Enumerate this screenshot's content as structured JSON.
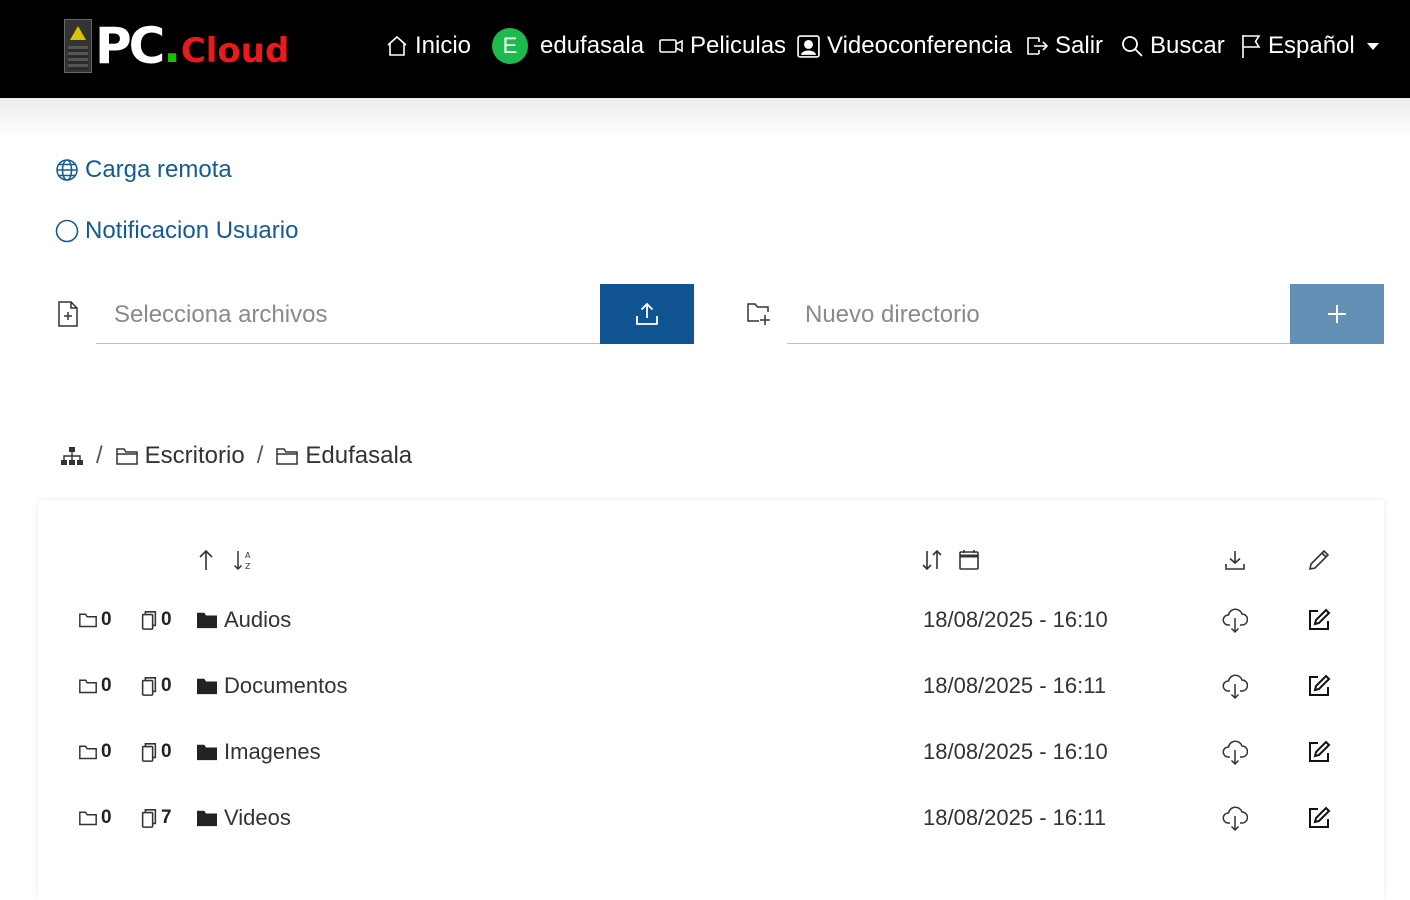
{
  "brand": {
    "pc": "PC",
    "dot": ".",
    "cloud": "Cloud"
  },
  "nav": {
    "home": "Inicio",
    "user_initial": "E",
    "user": "edufasala",
    "movies": "Peliculas",
    "videoconf": "Videoconferencia",
    "logout": "Salir",
    "search": "Buscar",
    "language": "Español"
  },
  "links": {
    "remote_upload": "Carga remota",
    "notification": "Notificacion Usuario"
  },
  "upload": {
    "placeholder": "Selecciona archivos"
  },
  "newdir": {
    "placeholder": "Nuevo directorio"
  },
  "breadcrumb": {
    "items": [
      "Escritorio",
      "Edufasala"
    ],
    "separator": "/"
  },
  "files": [
    {
      "folders": "0",
      "files": "0",
      "name": "Audios",
      "date": "18/08/2025 - 16:10"
    },
    {
      "folders": "0",
      "files": "0",
      "name": "Documentos",
      "date": "18/08/2025 - 16:11"
    },
    {
      "folders": "0",
      "files": "0",
      "name": "Imagenes",
      "date": "18/08/2025 - 16:10"
    },
    {
      "folders": "0",
      "files": "7",
      "name": "Videos",
      "date": "18/08/2025 - 16:11"
    }
  ],
  "colors": {
    "navbar": "#000000",
    "link": "#155a94",
    "upload_button": "#0f5390",
    "add_button": "#6490b6",
    "avatar": "#1fba4e",
    "brand_cloud": "#e81a1a"
  }
}
